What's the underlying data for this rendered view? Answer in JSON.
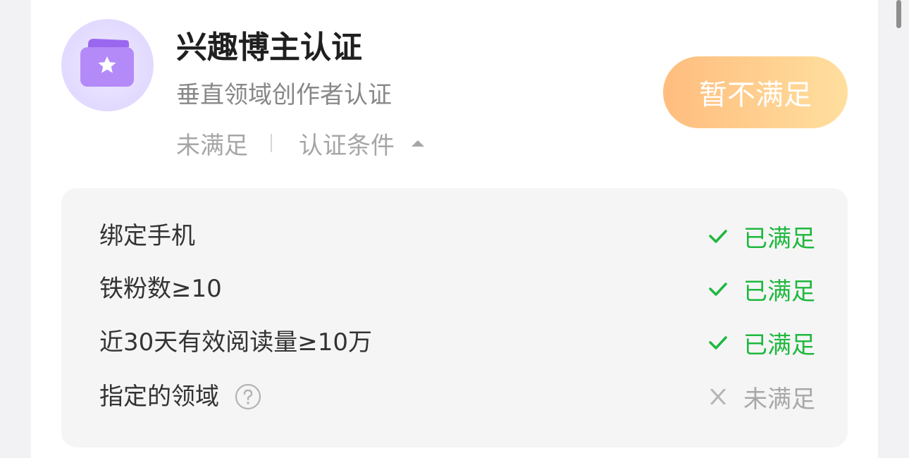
{
  "header": {
    "title": "兴趣博主认证",
    "subtitle": "垂直领域创作者认证",
    "status": "未满足",
    "conditions_toggle": "认证条件",
    "action_button": "暂不满足",
    "icon": "wallet-star-icon"
  },
  "conditions": [
    {
      "label": "绑定手机",
      "status": "已满足",
      "met": true
    },
    {
      "label": "铁粉数≥10",
      "status": "已满足",
      "met": true
    },
    {
      "label": "近30天有效阅读量≥10万",
      "status": "已满足",
      "met": true
    },
    {
      "label": "指定的领域",
      "status": "未满足",
      "met": false,
      "help": true
    }
  ],
  "colors": {
    "met": "#1fb83e",
    "unmet": "#a8a8a8",
    "button_gradient_start": "#ffbd7e",
    "button_gradient_end": "#ffdf9e",
    "avatar_accent": "#a57cf2"
  }
}
